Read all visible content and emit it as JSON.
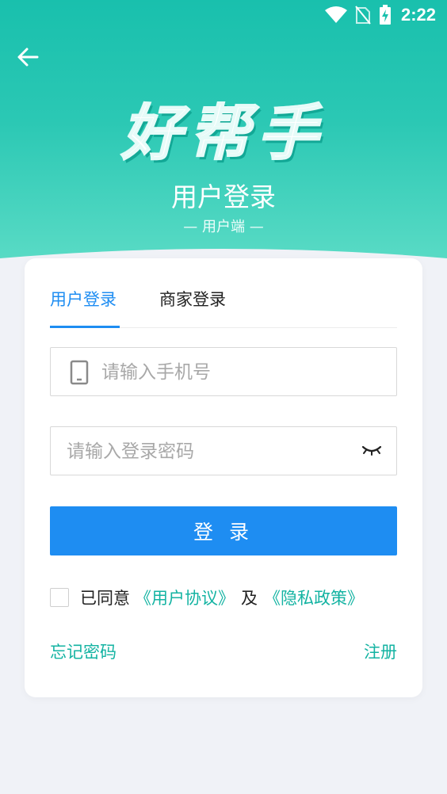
{
  "status_bar": {
    "time": "2:22",
    "icons": [
      "wifi-icon",
      "no-sim-icon",
      "battery-charging-icon"
    ]
  },
  "header": {
    "logo_text": "好帮手",
    "title": "用户登录",
    "subtitle": "— 用户端 —"
  },
  "tabs": [
    {
      "label": "用户登录",
      "active": true
    },
    {
      "label": "商家登录",
      "active": false
    }
  ],
  "form": {
    "phone_placeholder": "请输入手机号",
    "password_placeholder": "请输入登录密码",
    "login_label": "登 录"
  },
  "agreement": {
    "prefix": "已同意",
    "user_agreement": "《用户协议》",
    "and": "及",
    "privacy_policy": "《隐私政策》",
    "checked": false
  },
  "links": {
    "forgot_password": "忘记密码",
    "register": "注册"
  },
  "colors": {
    "header_teal": "#19c0ad",
    "primary_blue": "#1e8df2",
    "link_teal": "#13b3a2",
    "background": "#f0f2f7"
  }
}
